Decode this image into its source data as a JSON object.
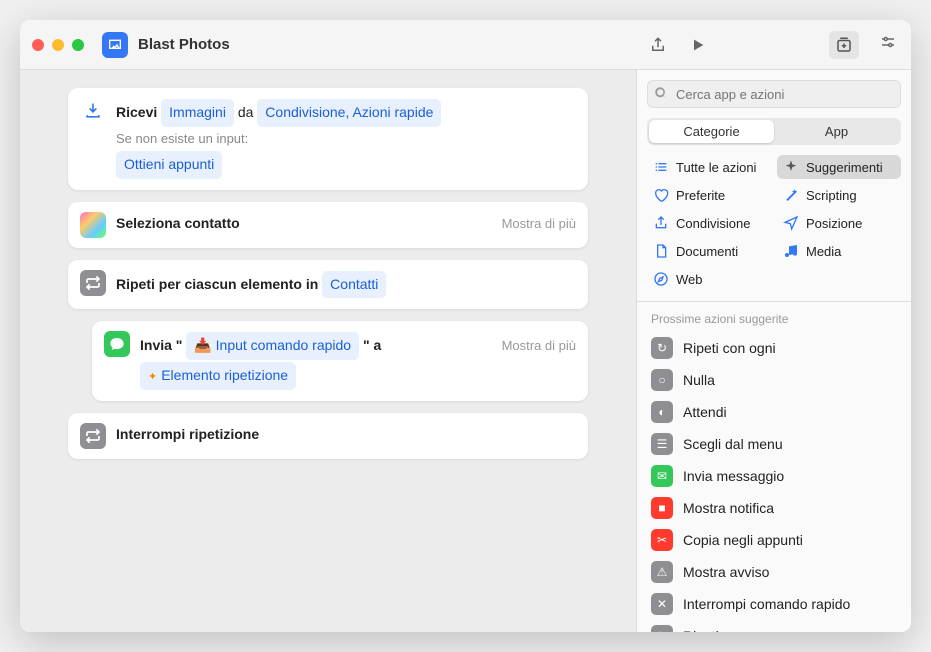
{
  "window": {
    "title": "Blast Photos"
  },
  "search": {
    "placeholder": "Cerca app e azioni"
  },
  "segments": {
    "categories": "Categorie",
    "app": "App"
  },
  "categories": {
    "all": "Tutte le azioni",
    "suggestions": "Suggerimenti",
    "favorites": "Preferite",
    "scripting": "Scripting",
    "sharing": "Condivisione",
    "location": "Posizione",
    "documents": "Documenti",
    "media": "Media",
    "web": "Web"
  },
  "editor": {
    "receive": {
      "prefix": "Ricevi",
      "input_type": "Immagini",
      "from": "da",
      "sources": "Condivisione, Azioni rapide",
      "no_input_label": "Se non esiste un input:",
      "fallback": "Ottieni appunti"
    },
    "select_contact": {
      "title": "Seleziona contatto",
      "more": "Mostra di più"
    },
    "repeat": {
      "prefix": "Ripeti per ciascun elemento in",
      "token": "Contatti"
    },
    "send": {
      "prefix": "Invia \"",
      "input_token": "Input comando rapido",
      "suffix": "\" a",
      "recipient_token": "Elemento ripetizione",
      "more": "Mostra di più"
    },
    "end_repeat": {
      "title": "Interrompi ripetizione"
    }
  },
  "suggestions": {
    "header": "Prossime azioni suggerite",
    "items": [
      {
        "label": "Ripeti con ogni",
        "bg": "#8e8e93",
        "glyph": "↻"
      },
      {
        "label": "Nulla",
        "bg": "#8e8e93",
        "glyph": "○"
      },
      {
        "label": "Attendi",
        "bg": "#8e8e93",
        "glyph": "◐"
      },
      {
        "label": "Scegli dal menu",
        "bg": "#8e8e93",
        "glyph": "☰"
      },
      {
        "label": "Invia messaggio",
        "bg": "#34c759",
        "glyph": "✉"
      },
      {
        "label": "Mostra notifica",
        "bg": "#ff3b30",
        "glyph": "■"
      },
      {
        "label": "Copia negli appunti",
        "bg": "#ff3b30",
        "glyph": "✂"
      },
      {
        "label": "Mostra avviso",
        "bg": "#8e8e93",
        "glyph": "⚠"
      },
      {
        "label": "Interrompi comando rapido",
        "bg": "#8e8e93",
        "glyph": "✕"
      },
      {
        "label": "Ripeti",
        "bg": "#8e8e93",
        "glyph": "↻"
      }
    ]
  },
  "colors": {
    "blue": "#3478f6",
    "green": "#34c759",
    "gray": "#8e8e93",
    "red": "#ff3b30"
  }
}
